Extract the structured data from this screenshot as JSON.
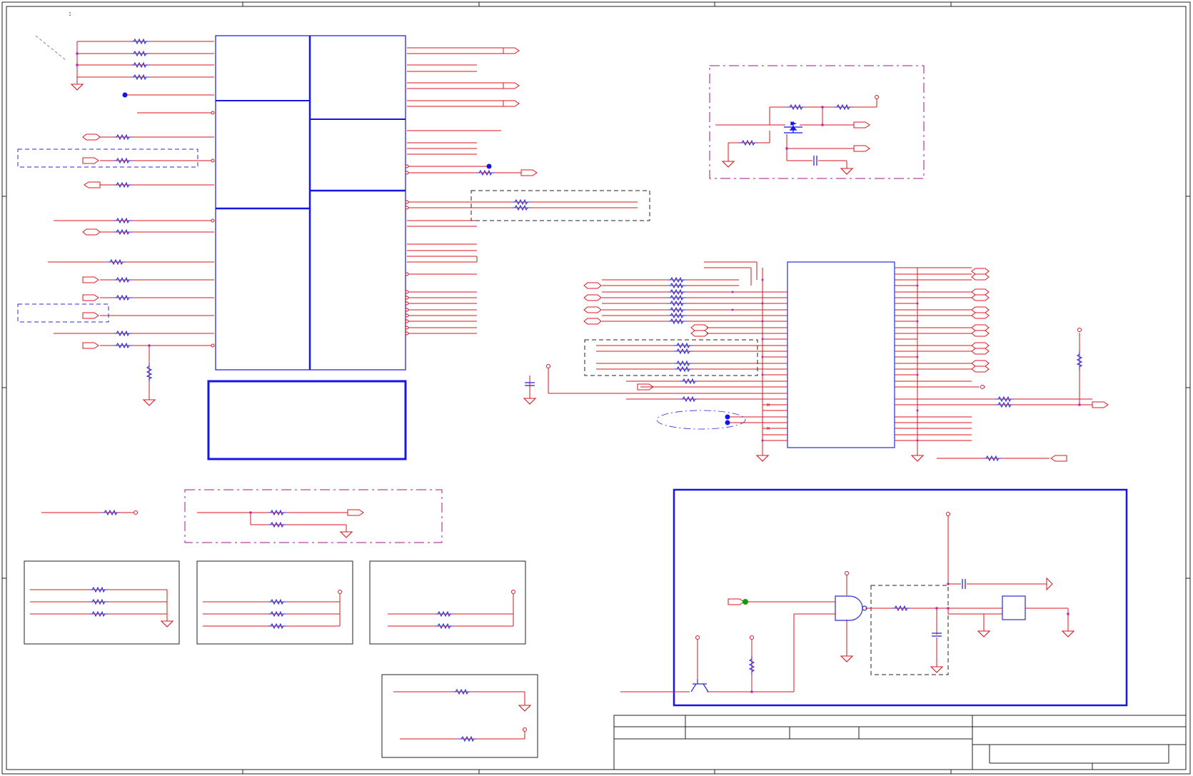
{
  "sheet": {
    "corner_mark": ":"
  },
  "colors": {
    "wire": "#d8141e",
    "net_label": "#e0141e",
    "component": "#2a2ad8",
    "frame_blue": "#1515e6",
    "dash_blue": "#2a2ad8",
    "dash_black": "#222222",
    "dash_purple": "#a0148c",
    "junction": "#c020c0",
    "junction_blue": "#1515e6",
    "junction_green": "#139a13",
    "border": "#222222"
  },
  "icons": {
    "resistor": "resistor-icon",
    "capacitor": "capacitor-icon",
    "ground": "ground-icon",
    "net_port": "net-port-icon",
    "power_pin": "power-pin-icon",
    "mosfet": "mosfet-icon",
    "and_gate": "and-gate-icon",
    "transistor": "transistor-icon",
    "junction": "junction-dot-icon",
    "ic": "ic-block-icon"
  }
}
